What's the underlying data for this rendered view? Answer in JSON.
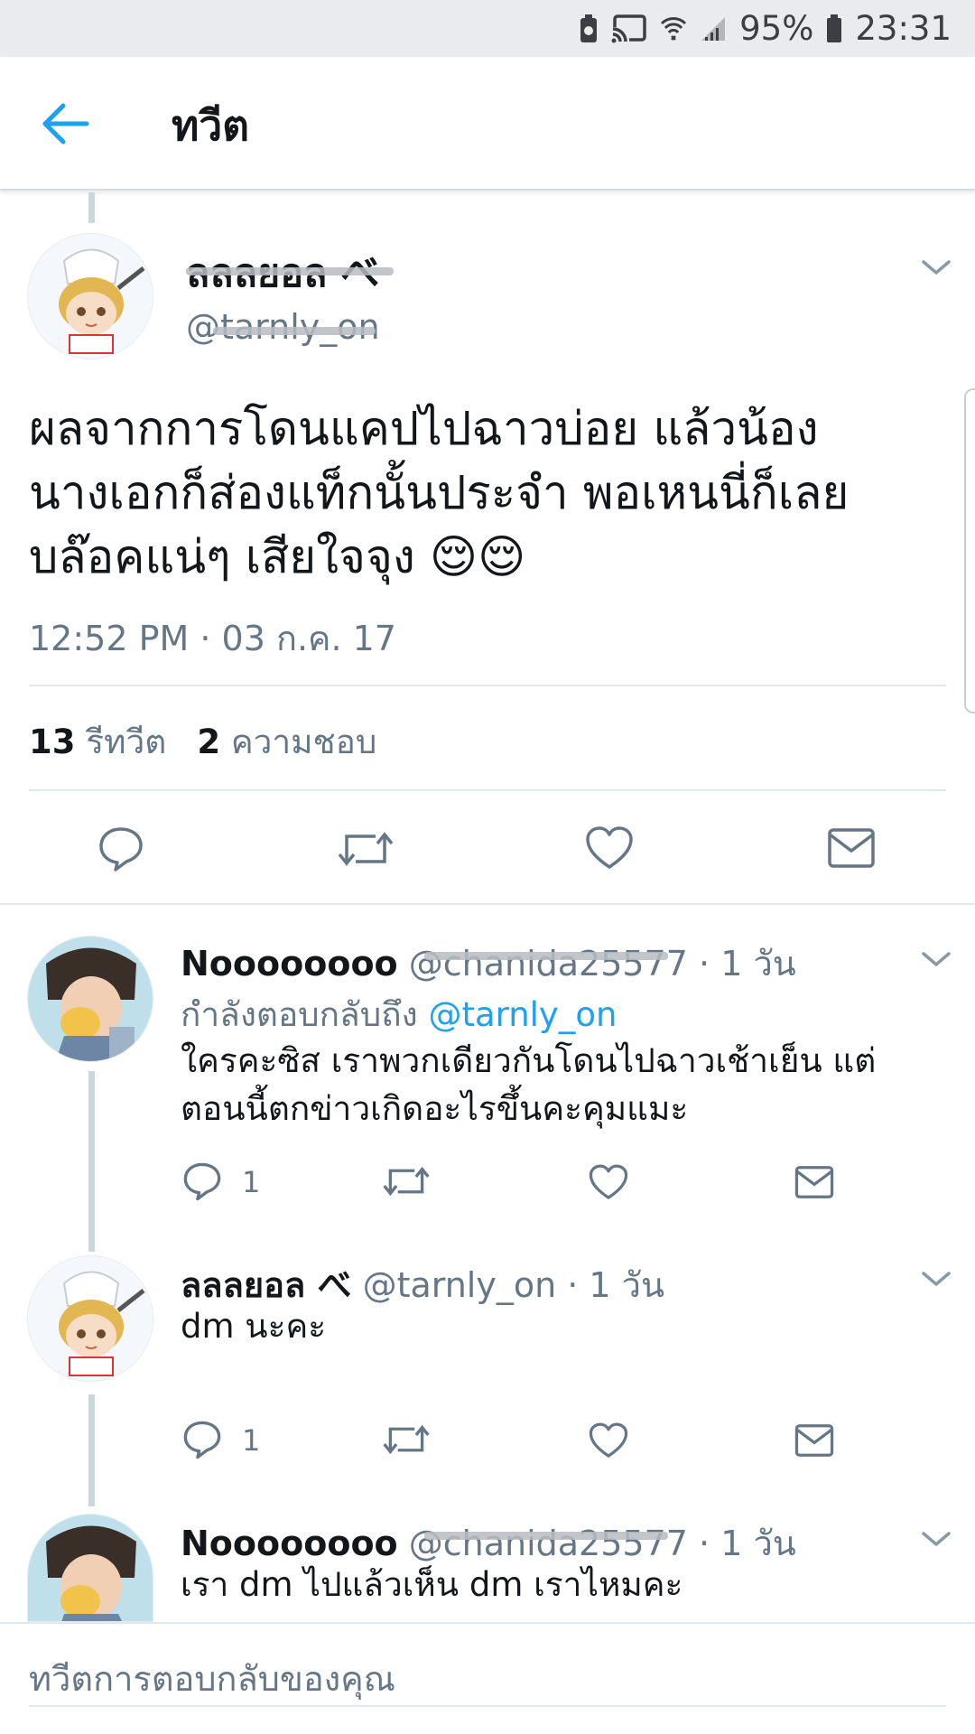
{
  "status_bar": {
    "battery": "95%",
    "time": "23:31"
  },
  "header": {
    "title": "ทวีต"
  },
  "main_tweet": {
    "name": "ลลลยอล べ",
    "handle": "@tarnly_on",
    "text_lines": [
      "ผลจากการโดนแคปไปฉาวบ่อย แล้วน้อง",
      "นางเอกก็ส่องแท็กนั้นประจำ พอเหนนี่ก็เลย",
      "บล๊อคแน่ๆ เสียใจจุง 😌😌"
    ],
    "timestamp": "12:52 PM · 03 ก.ค. 17",
    "retweet_count": "13",
    "retweet_label": "รีทวีต",
    "like_count": "2",
    "like_label": "ความชอบ"
  },
  "replies": [
    {
      "name": "Noooooooo",
      "handle": "@chanida25577",
      "age": "· 1 วัน",
      "replying_prefix": "กำลังตอบกลับถึง",
      "replying_to": "@tarnly_on",
      "text_lines": [
        "ใครคะซิส เราพวกเดียวกันโดนไปฉาวเช้าเย็น แต่",
        "ตอนนี้ตกข่าวเกิดอะไรขึ้นคะคุมแมะ"
      ],
      "reply_count": "1"
    },
    {
      "name": "ลลลยอล べ",
      "handle": "@tarnly_on",
      "age": "· 1 วัน",
      "text_lines": [
        "dm นะคะ"
      ],
      "reply_count": "1"
    },
    {
      "name": "Noooooooo",
      "handle": "@chanida25577",
      "age": "· 1 วัน",
      "text_lines": [
        "เรา dm ไปแล้วเห็น dm เราไหมคะ"
      ]
    }
  ],
  "compose": {
    "placeholder": "ทวีตการตอบกลับของคุณ"
  },
  "colors": {
    "accent": "#1da1f2",
    "muted": "#657786",
    "text": "#14171a",
    "line": "#ccd6dd"
  },
  "icons": [
    "back-arrow-icon",
    "reply-icon",
    "retweet-icon",
    "like-icon",
    "direct-message-icon",
    "chevron-down-icon"
  ]
}
